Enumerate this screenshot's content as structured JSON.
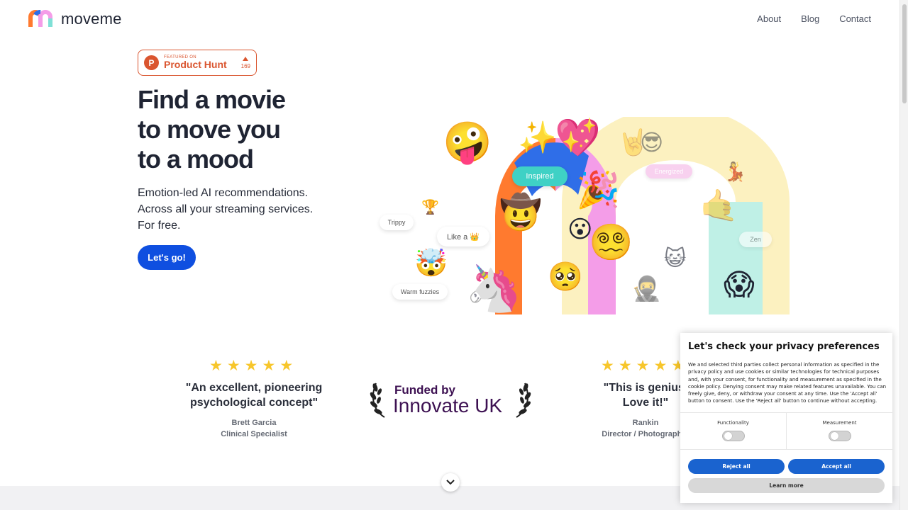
{
  "brand": {
    "name": "moveme"
  },
  "nav": {
    "items": [
      "About",
      "Blog",
      "Contact"
    ]
  },
  "product_hunt": {
    "featured": "FEATURED ON",
    "name": "Product Hunt",
    "votes": "169",
    "logo_letter": "P"
  },
  "hero": {
    "headline": [
      "Find a movie",
      "to move you",
      "to a mood"
    ],
    "subtitle": [
      "Emotion-led AI recommendations.",
      "Across all your streaming services.",
      "For free."
    ],
    "cta": "Let's go!"
  },
  "illustration": {
    "chips": [
      "Inspired",
      "Energized",
      "Trippy",
      "Like a 👑",
      "Warm fuzzies",
      "Zen"
    ]
  },
  "reviews": [
    {
      "stars": 5,
      "quote": [
        "\"An excellent, pioneering",
        "psychological concept\""
      ],
      "name": "Brett Garcia",
      "role": "Clinical Specialist"
    },
    {
      "stars": 5,
      "quote": [
        "\"This is genius.",
        "Love it!\""
      ],
      "name": "Rankin",
      "role": "Director / Photographer"
    }
  ],
  "innovate": {
    "funded_by": "Funded by",
    "name": "Innovate UK"
  },
  "cookie": {
    "title": "Let's check your privacy preferences",
    "body": "We and selected third parties collect personal information as specified in the privacy policy and use cookies or similar technologies for technical purposes and, with your consent, for functionality and measurement as specified in the cookie policy. Denying consent may make related features unavailable. You can freely give, deny, or withdraw your consent at any time. Use the 'Accept all' button to consent. Use the 'Reject all' button to continue without accepting.",
    "toggles": [
      {
        "label": "Functionality",
        "on": false
      },
      {
        "label": "Measurement",
        "on": false
      }
    ],
    "reject": "Reject all",
    "accept": "Accept all",
    "learn_more": "Learn more"
  },
  "colors": {
    "cta": "#0f4fe0",
    "product_hunt": "#da552f",
    "innovate": "#3d1152",
    "star": "#f7c62b",
    "cookie_button": "#1a63cf"
  }
}
